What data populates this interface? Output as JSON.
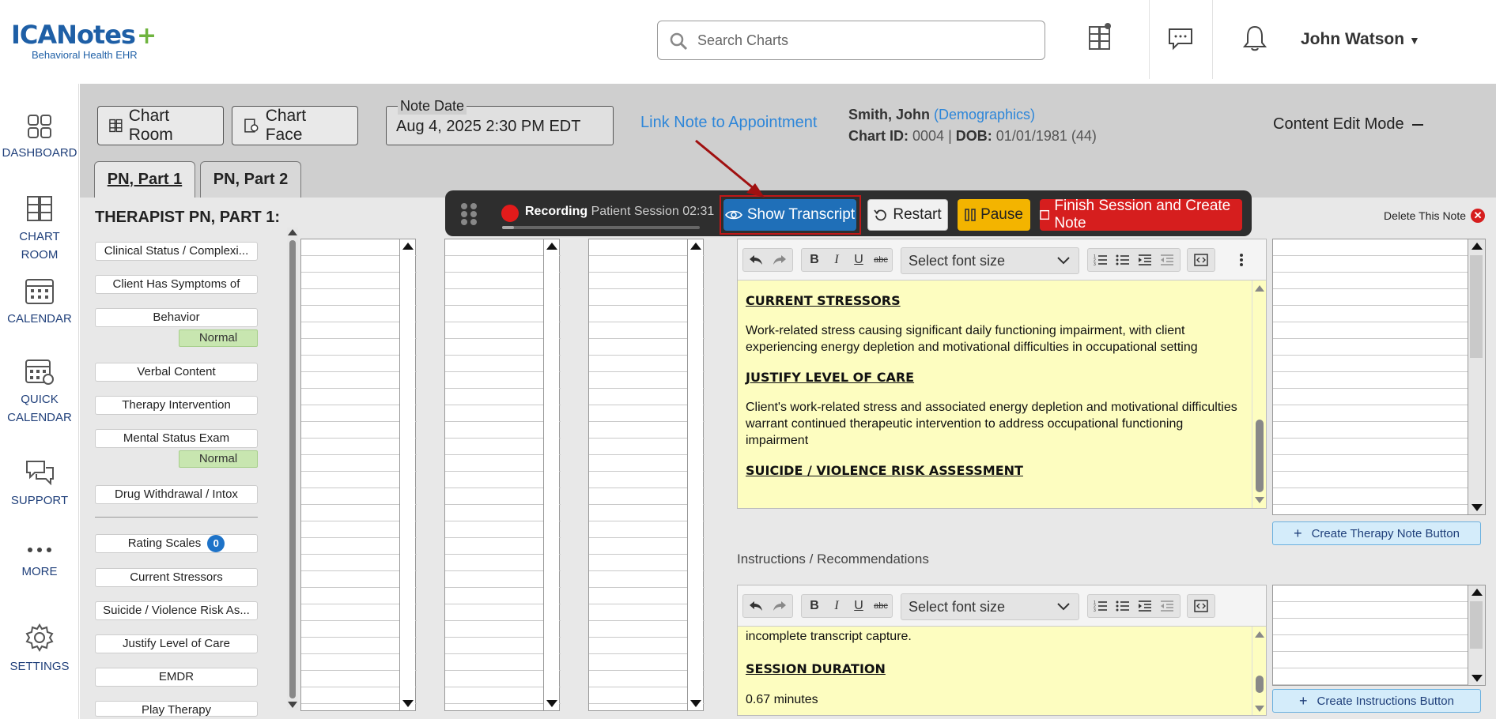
{
  "app": {
    "logo_main": "ICANotes",
    "logo_sub": "Behavioral Health EHR",
    "search_placeholder": "Search Charts",
    "user_name": "John Watson"
  },
  "sidebar": {
    "items": [
      {
        "label": "DASHBOARD",
        "icon": "dashboard-icon"
      },
      {
        "label": "CHART ROOM",
        "icon": "chart-room-icon"
      },
      {
        "label": "CALENDAR",
        "icon": "calendar-icon"
      },
      {
        "label": "QUICK CALENDAR",
        "icon": "quick-calendar-icon"
      },
      {
        "label": "SUPPORT",
        "icon": "support-icon"
      },
      {
        "label": "MORE",
        "icon": "more-icon"
      },
      {
        "label": "SETTINGS",
        "icon": "settings-icon"
      }
    ]
  },
  "header": {
    "chart_room": "Chart Room",
    "chart_face": "Chart Face",
    "note_date_label": "Note Date",
    "note_date_value": "Aug 4, 2025 2:30 PM EDT",
    "link_note": "Link Note to Appointment",
    "patient_name": "Smith, John",
    "demographics": "(Demographics)",
    "chart_id_label": "Chart ID:",
    "chart_id": "0004",
    "sep": "|",
    "dob_label": "DOB:",
    "dob": "01/01/1981 (44)",
    "content_mode": "Content Edit Mode"
  },
  "tabs": [
    {
      "label": "PN, Part 1",
      "active": true
    },
    {
      "label": "PN, Part 2",
      "active": false
    }
  ],
  "panel": {
    "title": "THERAPIST PN, PART 1:",
    "delete_note": "Delete This Note",
    "left_buttons": [
      "Clinical Status / Complexi...",
      "Client Has Symptoms of",
      "Behavior",
      "Verbal Content",
      "Therapy Intervention",
      "Mental Status Exam",
      "Drug Withdrawal / Intox",
      "Rating Scales",
      "Current Stressors",
      "Suicide / Violence Risk As...",
      "Justify Level of Care",
      "EMDR",
      "Play Therapy"
    ],
    "normal_badge": "Normal",
    "rating_count": "0"
  },
  "recording": {
    "status": "Recording",
    "session": "Patient Session 02:31",
    "progress_fraction": 0.06,
    "show_transcript": "Show Transcript",
    "restart": "Restart",
    "pause": "Pause",
    "finish": "Finish Session and Create Note"
  },
  "editor1": {
    "font_size_placeholder": "Select font size",
    "heading1": "CURRENT STRESSORS",
    "para1": "Work-related stress causing significant daily functioning impairment, with client experiencing energy depletion and motivational difficulties in occupational setting",
    "heading2": "JUSTIFY LEVEL OF CARE",
    "para2": "Client's work-related stress and associated energy depletion and motivational difficulties warrant continued therapeutic intervention to address occupational functioning impairment",
    "heading3": "SUICIDE / VIOLENCE RISK ASSESSMENT"
  },
  "instructions": {
    "label": "Instructions / Recommendations"
  },
  "editor2": {
    "font_size_placeholder": "Select font size",
    "line1": "incomplete transcript capture.",
    "heading1": "SESSION DURATION",
    "para1": "0.67 minutes"
  },
  "buttons": {
    "create_therapy": "Create Therapy Note Button",
    "create_instructions": "Create Instructions Button"
  },
  "colors": {
    "brand_blue": "#1e5fa6",
    "brand_green": "#6fb43f",
    "link_blue": "#2d86d9",
    "record_red": "#e31b1b",
    "pause_yellow": "#f3b400",
    "finish_red": "#d61e1e",
    "editor_yellow": "#fdfdc0"
  }
}
